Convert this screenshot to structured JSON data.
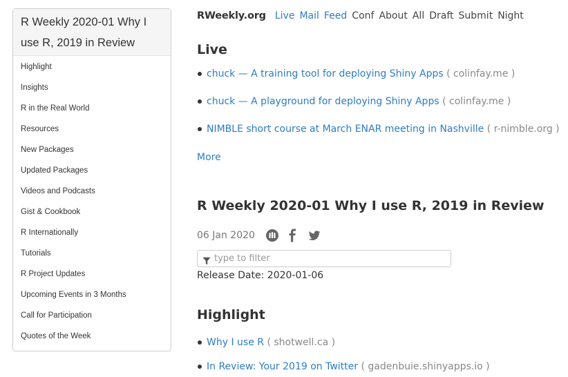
{
  "sidebar": {
    "title": "R Weekly 2020-01 Why I use R, 2019 in Review",
    "items": [
      {
        "label": "Highlight"
      },
      {
        "label": "Insights"
      },
      {
        "label": "R in the Real World"
      },
      {
        "label": "Resources"
      },
      {
        "label": "New Packages"
      },
      {
        "label": "Updated Packages"
      },
      {
        "label": "Videos and Podcasts"
      },
      {
        "label": "Gist & Cookbook"
      },
      {
        "label": "R Internationally"
      },
      {
        "label": "Tutorials"
      },
      {
        "label": "R Project Updates"
      },
      {
        "label": "Upcoming Events in 3 Months"
      },
      {
        "label": "Call for Participation"
      },
      {
        "label": "Quotes of the Week"
      }
    ]
  },
  "nav": {
    "brand": "RWeekly.org",
    "links": [
      {
        "label": "Live",
        "style": "blue"
      },
      {
        "label": "Mail",
        "style": "blue"
      },
      {
        "label": "Feed",
        "style": "blue"
      },
      {
        "label": "Conf",
        "style": "dark"
      },
      {
        "label": "About",
        "style": "dark"
      },
      {
        "label": "All",
        "style": "dark"
      },
      {
        "label": "Draft",
        "style": "dark"
      },
      {
        "label": "Submit",
        "style": "dark"
      },
      {
        "label": "Night",
        "style": "dark"
      }
    ]
  },
  "live": {
    "heading": "Live",
    "items": [
      {
        "title": "chuck — A training tool for deploying Shiny Apps",
        "domain": "( colinfay.me )"
      },
      {
        "title": "chuck — A playground for deploying Shiny Apps",
        "domain": "( colinfay.me )"
      },
      {
        "title": "NIMBLE short course at March ENAR meeting in Nashville",
        "domain": "( r-nimble.org )"
      }
    ],
    "more_label": "More"
  },
  "post": {
    "title": "R Weekly 2020-01 Why I use R, 2019 in Review",
    "date": "06 Jan 2020",
    "share_icons": [
      "hackernews-icon",
      "facebook-icon",
      "twitter-icon"
    ],
    "filter_placeholder": "type to filter",
    "filter_value": "",
    "release_date": "Release Date: 2020-01-06"
  },
  "highlight": {
    "heading": "Highlight",
    "items": [
      {
        "title": "Why I use R",
        "domain": "( shotwell.ca )"
      },
      {
        "title": "In Review: Your 2019 on Twitter",
        "domain": "( gadenbuie.shinyapps.io )"
      }
    ]
  },
  "colors": {
    "link": "#2d7cc4",
    "text": "#333333",
    "muted": "#888888",
    "sidebar_header_bg": "#f5f5f5"
  }
}
